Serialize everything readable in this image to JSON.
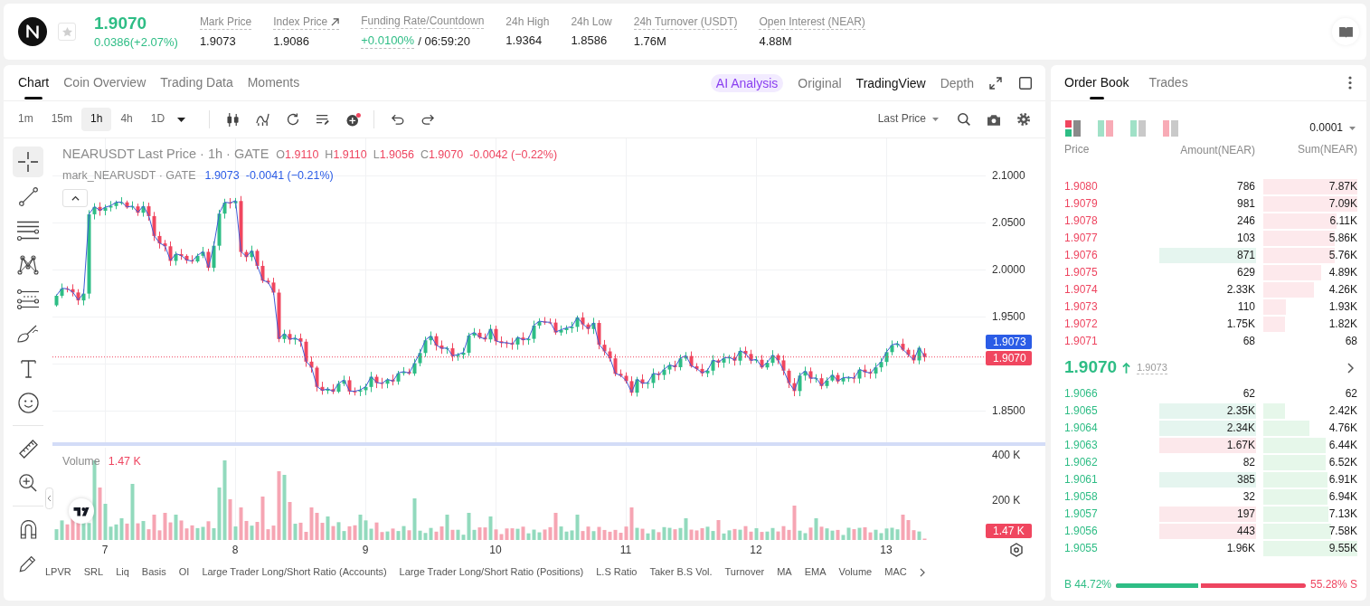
{
  "header": {
    "favorite": false,
    "price": "1.9070",
    "change": "0.0386(+2.07%)",
    "up": true,
    "stats": [
      {
        "label": "Mark Price",
        "value": "1.9073",
        "label_dotted": true,
        "value_dotted": false,
        "linked": false,
        "up": false
      },
      {
        "label": "Index Price",
        "value": "1.9086",
        "label_dotted": true,
        "value_dotted": false,
        "linked": true,
        "up": false
      },
      {
        "label": "Funding Rate/Countdown",
        "value": "+0.0100%",
        "countdown": "/ 06:59:20",
        "label_dotted": true,
        "value_dotted": true,
        "linked": false,
        "up": true
      },
      {
        "label": "24h High",
        "value": "1.9364",
        "label_dotted": false,
        "value_dotted": false,
        "linked": false,
        "up": false
      },
      {
        "label": "24h Low",
        "value": "1.8586",
        "label_dotted": false,
        "value_dotted": false,
        "linked": false,
        "up": false
      },
      {
        "label": "24h Turnover (USDT)",
        "value": "1.76M",
        "label_dotted": true,
        "value_dotted": false,
        "linked": false,
        "up": false
      },
      {
        "label": "Open Interest (NEAR)",
        "value": "4.88M",
        "label_dotted": true,
        "value_dotted": false,
        "linked": false,
        "up": false
      }
    ]
  },
  "chart": {
    "tabs": [
      {
        "label": "Chart",
        "selected": true
      },
      {
        "label": "Coin Overview",
        "selected": false
      },
      {
        "label": "Trading Data",
        "selected": false
      },
      {
        "label": "Moments",
        "selected": false
      }
    ],
    "views": [
      {
        "label": "AI Analysis",
        "kind": "ai",
        "selected": false
      },
      {
        "label": "Original",
        "kind": "plain",
        "selected": false
      },
      {
        "label": "TradingView",
        "kind": "plain",
        "selected": true
      },
      {
        "label": "Depth",
        "kind": "plain",
        "selected": false
      }
    ],
    "intervals": [
      {
        "label": "1m",
        "selected": false
      },
      {
        "label": "15m",
        "selected": false
      },
      {
        "label": "1h",
        "selected": true
      },
      {
        "label": "4h",
        "selected": false
      },
      {
        "label": "1D",
        "selected": false
      }
    ],
    "price_source": "Last Price",
    "tool_groups": [
      [
        {
          "kind": "crosshair",
          "selected": true
        },
        {
          "kind": "trend_line",
          "selected": false
        },
        {
          "kind": "horizontal_lines",
          "selected": false
        },
        {
          "kind": "pattern",
          "selected": false
        },
        {
          "kind": "fib_lines",
          "selected": false
        },
        {
          "kind": "brush",
          "selected": false
        },
        {
          "kind": "text",
          "selected": false
        },
        {
          "kind": "emoji",
          "selected": false
        }
      ],
      [
        {
          "kind": "ruler",
          "selected": false
        },
        {
          "kind": "zoom_in",
          "selected": false
        }
      ],
      [
        {
          "kind": "magnet",
          "selected": false
        },
        {
          "kind": "pencil",
          "selected": false
        }
      ]
    ],
    "legend": {
      "title": "NEARUSDT Last Price · 1h · GATE",
      "up": false,
      "ohlc": [
        {
          "key": "O",
          "value": "1.9110"
        },
        {
          "key": "H",
          "value": "1.9110"
        },
        {
          "key": "L",
          "value": "1.9056"
        },
        {
          "key": "C",
          "value": "1.9070"
        }
      ],
      "change": "-0.0042 (−0.22%)",
      "mark_title": "mark_NEARUSDT · GATE",
      "mark_value": "1.9073",
      "mark_change": "-0.0041 (−0.21%)"
    },
    "price_axis": [
      "2.1000",
      "2.0500",
      "2.0000",
      "1.9500",
      "1.8500"
    ],
    "price_tags": [
      {
        "text": "1.9073",
        "color": "#2b5ce6"
      },
      {
        "text": "1.9070",
        "color": "#f0465f"
      }
    ],
    "volume": {
      "label": "Volume",
      "value": "1.47 K",
      "up": false,
      "axis": [
        "400 K",
        "200 K"
      ],
      "tag": "1.47 K"
    },
    "time_axis": [
      "7",
      "8",
      "9",
      "10",
      "11",
      "12",
      "13"
    ],
    "indicators": [
      "LPVR",
      "SRL",
      "Liq",
      "Basis",
      "OI",
      "Large Trader Long/Short Ratio (Accounts)",
      "Large Trader Long/Short Ratio (Positions)",
      "L.S Ratio",
      "Taker B.S Vol.",
      "Turnover",
      "MA",
      "EMA",
      "Volume",
      "MAC"
    ]
  },
  "order_book": {
    "tabs": [
      {
        "label": "Order Book",
        "selected": true
      },
      {
        "label": "Trades",
        "selected": false
      }
    ],
    "layouts": [
      {
        "kind": "both",
        "selected": true
      },
      {
        "kind": "split",
        "selected": false
      },
      {
        "kind": "bids",
        "selected": false
      },
      {
        "kind": "asks",
        "selected": false
      }
    ],
    "precision": "0.0001",
    "columns": [
      "Price",
      "Amount(NEAR)",
      "Sum(NEAR)"
    ],
    "asks": [
      {
        "price": "1.9080",
        "amount": "786",
        "sum": "7.87K",
        "kind": "plain"
      },
      {
        "price": "1.9079",
        "amount": "981",
        "sum": "7.09K",
        "kind": "plain"
      },
      {
        "price": "1.9078",
        "amount": "246",
        "sum": "6.11K",
        "kind": "plain"
      },
      {
        "price": "1.9077",
        "amount": "103",
        "sum": "5.86K",
        "kind": "plain"
      },
      {
        "price": "1.9076",
        "amount": "871",
        "sum": "5.76K",
        "kind": "flash_up"
      },
      {
        "price": "1.9075",
        "amount": "629",
        "sum": "4.89K",
        "kind": "plain"
      },
      {
        "price": "1.9074",
        "amount": "2.33K",
        "sum": "4.26K",
        "kind": "plain"
      },
      {
        "price": "1.9073",
        "amount": "110",
        "sum": "1.93K",
        "kind": "plain"
      },
      {
        "price": "1.9072",
        "amount": "1.75K",
        "sum": "1.82K",
        "kind": "plain"
      },
      {
        "price": "1.9071",
        "amount": "68",
        "sum": "68",
        "kind": "plain"
      }
    ],
    "mid": {
      "price": "1.9070",
      "up": true,
      "mark": "1.9073"
    },
    "bids": [
      {
        "price": "1.9066",
        "amount": "62",
        "sum": "62",
        "kind": "plain"
      },
      {
        "price": "1.9065",
        "amount": "2.35K",
        "sum": "2.42K",
        "kind": "flash_up"
      },
      {
        "price": "1.9064",
        "amount": "2.34K",
        "sum": "4.76K",
        "kind": "flash_up"
      },
      {
        "price": "1.9063",
        "amount": "1.67K",
        "sum": "6.44K",
        "kind": "flash_down"
      },
      {
        "price": "1.9062",
        "amount": "82",
        "sum": "6.52K",
        "kind": "plain"
      },
      {
        "price": "1.9061",
        "amount": "385",
        "sum": "6.91K",
        "kind": "flash_up"
      },
      {
        "price": "1.9058",
        "amount": "32",
        "sum": "6.94K",
        "kind": "plain"
      },
      {
        "price": "1.9057",
        "amount": "197",
        "sum": "7.13K",
        "kind": "flash_down"
      },
      {
        "price": "1.9056",
        "amount": "443",
        "sum": "7.58K",
        "kind": "flash_down"
      },
      {
        "price": "1.9055",
        "amount": "1.96K",
        "sum": "9.55K",
        "kind": "plain"
      }
    ],
    "ratio": {
      "buy": "B 44.72%",
      "sell": "55.28% S",
      "level": 0.4472
    }
  }
}
